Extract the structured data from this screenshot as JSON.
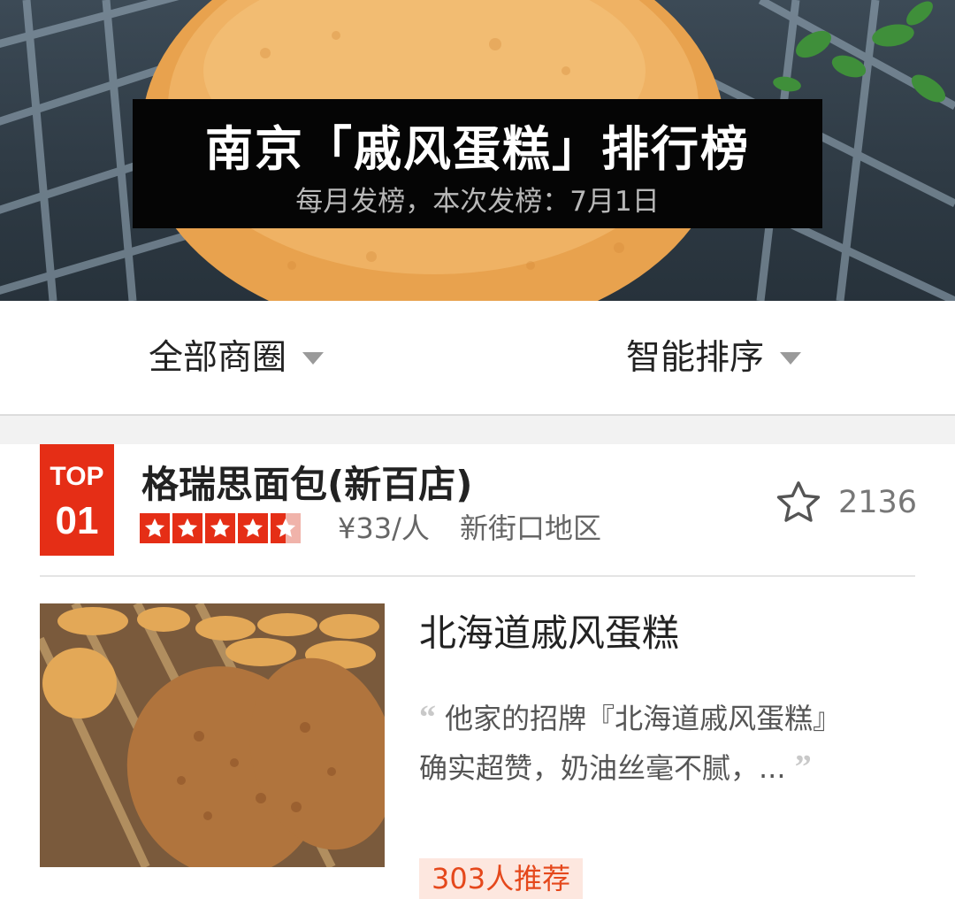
{
  "banner": {
    "title": "南京「戚风蛋糕」排行榜",
    "subtitle": "每月发榜，本次发榜：7月1日"
  },
  "filters": {
    "area_label": "全部商圈",
    "sort_label": "智能排序"
  },
  "shop": {
    "rank_prefix": "TOP",
    "rank_number": "01",
    "name": "格瑞思面包(新百店)",
    "rating_stars": 4.5,
    "price": "¥33/人",
    "region": "新街口地区",
    "favorite_count": "2136"
  },
  "dish": {
    "name": "北海道戚风蛋糕",
    "review": "他家的招牌『北海道戚风蛋糕』确实超赞，奶油丝毫不腻，...",
    "recommend": "303人推荐"
  },
  "colors": {
    "accent": "#e52e16",
    "recommend_bg": "#fde7df",
    "recommend_text": "#e5481c"
  },
  "icons": [
    "chevron-down-icon",
    "star-icon",
    "star-outline-icon",
    "quote-open-icon",
    "quote-close-icon"
  ]
}
